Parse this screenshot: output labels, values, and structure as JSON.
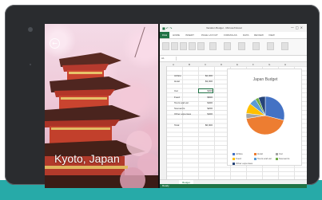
{
  "photo": {
    "caption": "Kyoto, Japan",
    "back_icon": "arrow-left-icon"
  },
  "excel": {
    "window_title": "Vacation Budget - Microsoft Excel",
    "ribbon_tabs": [
      "FILE",
      "HOME",
      "INSERT",
      "PAGE LAYOUT",
      "FORMULAS",
      "DATA",
      "REVIEW",
      "VIEW"
    ],
    "name_box": "A1",
    "sheet_tab": "Budget",
    "status": "Ready",
    "budget_rows": [
      {
        "label": "Airfare",
        "value": "$2,000"
      },
      {
        "label": "Hotel",
        "value": "$3,000"
      },
      {
        "label": "Car",
        "value": "$300"
      },
      {
        "label": "Food",
        "value": "$600"
      },
      {
        "label": "Tours and etc.",
        "value": "$400"
      },
      {
        "label": "Souvenirs",
        "value": "$200"
      },
      {
        "label": "Other expenses",
        "value": "$400"
      }
    ],
    "total": {
      "label": "Total",
      "value": "$6,900"
    }
  },
  "chart_data": {
    "type": "pie",
    "title": "Japan Budget",
    "categories": [
      "Airfare",
      "Hotel",
      "Car",
      "Food",
      "Tours and etc.",
      "Souvenirs",
      "Other expenses"
    ],
    "values": [
      2000,
      3000,
      300,
      600,
      400,
      200,
      400
    ],
    "colors": [
      "#4472c4",
      "#ed7d31",
      "#a5a5a5",
      "#ffc000",
      "#5b9bd5",
      "#70ad47",
      "#264478"
    ],
    "legend_position": "bottom"
  }
}
